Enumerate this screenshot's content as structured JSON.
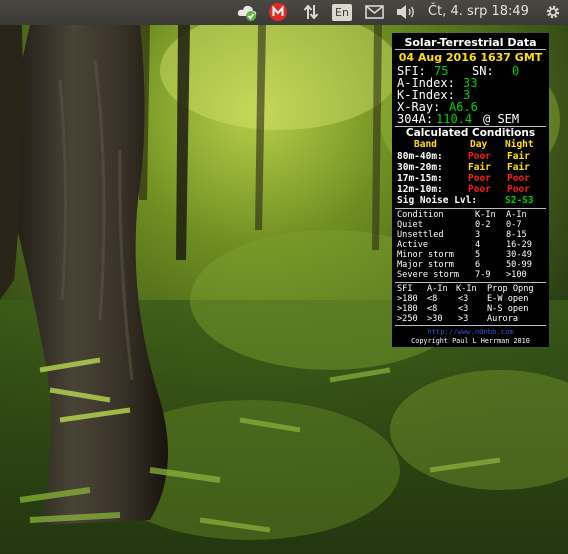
{
  "topbar": {
    "icons": [
      "cloud-sync-icon",
      "mail-notify-icon",
      "network-transfer-icon",
      "keyboard-layout-icon",
      "envelope-icon",
      "volume-icon",
      "settings-gear-icon"
    ],
    "keyboard_layout": "En",
    "clock": "Čt, 4. srp 18:49",
    "colors": {
      "panel": "#3c3b37",
      "mail_badge": "#e12a26",
      "sync_check": "#5fb53d"
    }
  },
  "conky": {
    "title": "Solar-Terrestrial Data",
    "date": "04 Aug 2016 1637 GMT",
    "sfi_label": "SFI:",
    "sfi": "75",
    "sn_label": "SN:",
    "sn": "0",
    "a_index_label": "A-Index:",
    "a_index": "33",
    "k_index_label": "K-Index:",
    "k_index": "3",
    "xray_label": "X-Ray:",
    "xray": "A6.6",
    "sem_label": "304A:",
    "sem": "110.4",
    "sem_suffix": "@ SEM",
    "conditions_title": "Calculated Conditions",
    "cond_headers": [
      "Band",
      "Day",
      "Night"
    ],
    "bands": [
      {
        "band": "80m-40m:",
        "day": "Poor",
        "night": "Fair"
      },
      {
        "band": "30m-20m:",
        "day": "Fair",
        "night": "Fair"
      },
      {
        "band": "17m-15m:",
        "day": "Poor",
        "night": "Poor"
      },
      {
        "band": "12m-10m:",
        "day": "Poor",
        "night": "Poor"
      }
    ],
    "sig_noise_label": "Sig Noise Lvl:",
    "sig_noise": "S2-S3",
    "ref_headers": [
      "Condition",
      "K-In",
      "A-In"
    ],
    "ref_rows": [
      [
        "Quiet",
        "0-2",
        "0-7"
      ],
      [
        "Unsettled",
        "3",
        "8-15"
      ],
      [
        "Active",
        "4",
        "16-29"
      ],
      [
        "Minor storm",
        "5",
        "30-49"
      ],
      [
        "Major storm",
        "6",
        "50-99"
      ],
      [
        "Severe storm",
        "7-9",
        ">100"
      ]
    ],
    "prop_headers": [
      "SFI",
      "A-In",
      "K-In",
      "Prop Opng"
    ],
    "prop_rows": [
      [
        ">180",
        "<8",
        "<3",
        "E-W open"
      ],
      [
        ">180",
        "<8",
        "<3",
        "N-S open"
      ],
      [
        ">250",
        ">30",
        ">3",
        "Aurora"
      ]
    ],
    "url": "http://www.n0nbh.com",
    "copyright": "Copyright Paul L Herrman 2010",
    "colors": {
      "value": "#00d200",
      "highlight": "#ffe000",
      "poor": "#ff1a1a",
      "link": "#2f55d4"
    }
  }
}
